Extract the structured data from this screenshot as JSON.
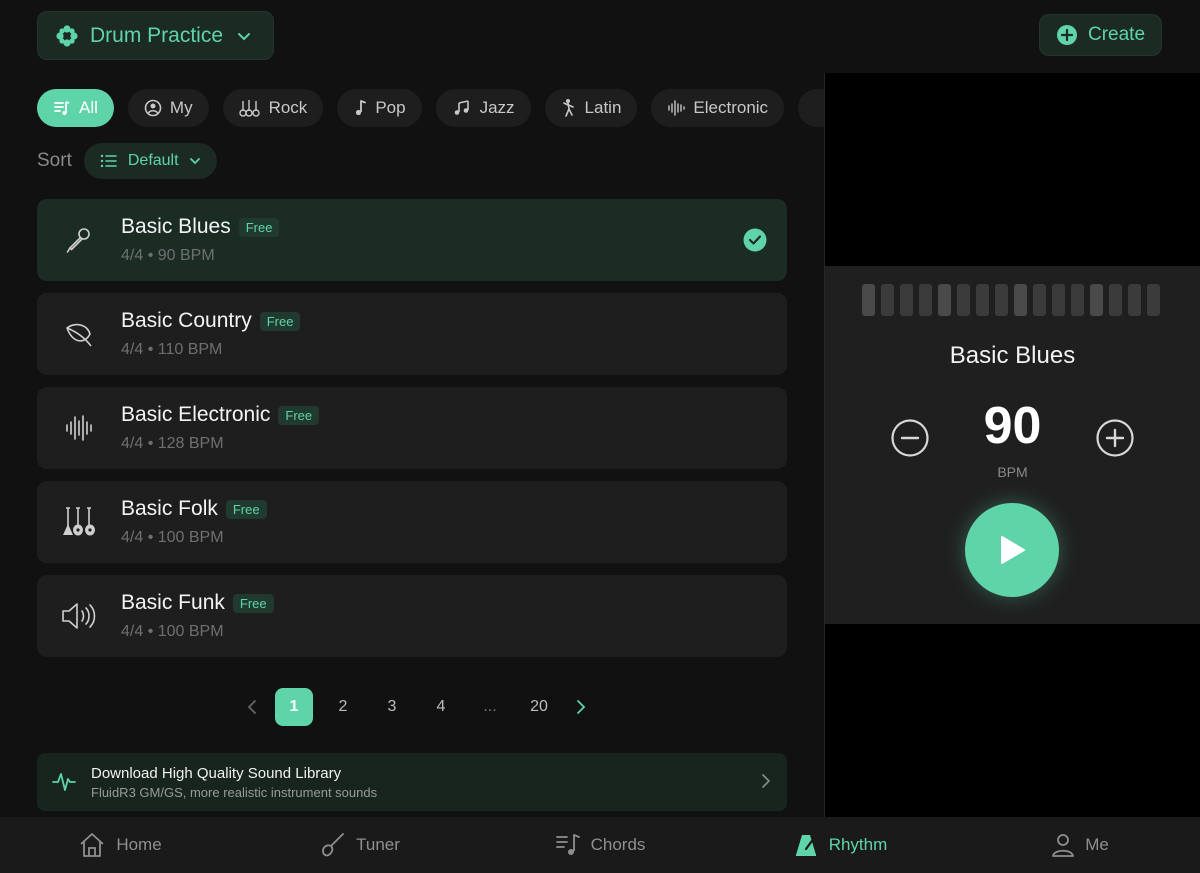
{
  "header": {
    "app_title": "Drum Practice",
    "create_label": "Create"
  },
  "tabs": [
    {
      "label": "All",
      "icon": "music-list-icon",
      "active": true
    },
    {
      "label": "My",
      "icon": "user-circle-icon",
      "active": false
    },
    {
      "label": "Rock",
      "icon": "guitars-icon",
      "active": false
    },
    {
      "label": "Pop",
      "icon": "music-note-icon",
      "active": false
    },
    {
      "label": "Jazz",
      "icon": "music-notes-icon",
      "active": false
    },
    {
      "label": "Latin",
      "icon": "dancer-icon",
      "active": false
    },
    {
      "label": "Electronic",
      "icon": "waveform-icon",
      "active": false
    }
  ],
  "sort": {
    "label": "Sort",
    "value": "Default"
  },
  "rhythms": [
    {
      "title": "Basic Blues",
      "badge": "Free",
      "meta": "4/4 • 90 BPM",
      "icon": "microphone-icon",
      "selected": true
    },
    {
      "title": "Basic Country",
      "badge": "Free",
      "meta": "4/4 • 110 BPM",
      "icon": "leaf-icon",
      "selected": false
    },
    {
      "title": "Basic Electronic",
      "badge": "Free",
      "meta": "4/4 • 128 BPM",
      "icon": "waveform-icon",
      "selected": false
    },
    {
      "title": "Basic Folk",
      "badge": "Free",
      "meta": "4/4 • 100 BPM",
      "icon": "guitars-icon",
      "selected": false
    },
    {
      "title": "Basic Funk",
      "badge": "Free",
      "meta": "4/4 • 100 BPM",
      "icon": "speaker-icon",
      "selected": false
    }
  ],
  "pagination": {
    "pages": [
      "1",
      "2",
      "3",
      "4",
      "...",
      "20"
    ],
    "current": "1"
  },
  "banner": {
    "title": "Download High Quality Sound Library",
    "subtitle": "FluidR3 GM/GS, more realistic instrument sounds"
  },
  "player": {
    "title": "Basic Blues",
    "bpm": "90",
    "bpm_label": "BPM",
    "beat_count": 16,
    "strong_beats": [
      0,
      4,
      8,
      12
    ]
  },
  "nav": [
    {
      "label": "Home",
      "icon": "home-icon",
      "active": false
    },
    {
      "label": "Tuner",
      "icon": "tuner-icon",
      "active": false
    },
    {
      "label": "Chords",
      "icon": "chords-icon",
      "active": false
    },
    {
      "label": "Rhythm",
      "icon": "metronome-icon",
      "active": true
    },
    {
      "label": "Me",
      "icon": "person-icon",
      "active": false
    }
  ],
  "colors": {
    "accent": "#5fd4a8",
    "background": "#111111",
    "card": "#1e1e1e",
    "selected_card": "#1b2c25"
  }
}
